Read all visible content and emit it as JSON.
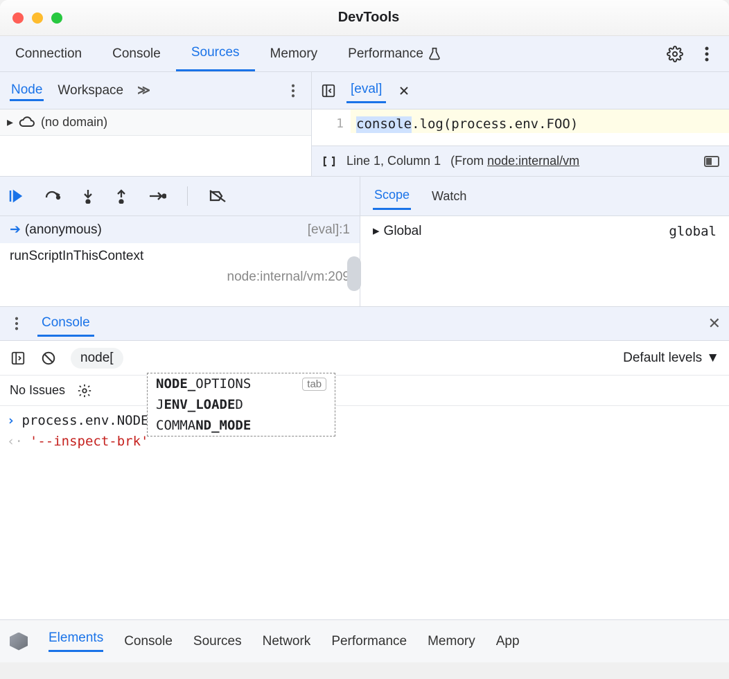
{
  "window": {
    "title": "DevTools"
  },
  "main_tabs": {
    "connection": "Connection",
    "console": "Console",
    "sources": "Sources",
    "memory": "Memory",
    "performance": "Performance"
  },
  "left": {
    "subtabs": {
      "node": "Node",
      "workspace": "Workspace"
    },
    "tree": {
      "no_domain": "(no domain)"
    }
  },
  "file": {
    "tab_name": "[eval]",
    "line_no": "1",
    "code_prefix": "console",
    "code_rest": ".log(process.env.FOO)"
  },
  "status": {
    "location": "Line 1, Column 1",
    "from_label": "(From ",
    "from_link": "node:internal/vm"
  },
  "scope_tabs": {
    "scope": "Scope",
    "watch": "Watch"
  },
  "callstack": {
    "frame0": {
      "name": "(anonymous)",
      "loc": "[eval]:1"
    },
    "frame1": {
      "name": "runScriptInThisContext",
      "loc": "node:internal/vm:209"
    }
  },
  "scope": {
    "global_label": "Global",
    "global_value": "global"
  },
  "drawer": {
    "tab": "Console",
    "context": "node[",
    "levels": "Default levels",
    "issues": "No Issues",
    "input": "process.env.NODE",
    "return_value": "'--inspect-brk'",
    "autocomplete": {
      "opt1_bold": "NODE_",
      "opt1_rest": "OPTIONS",
      "tab_hint": "tab",
      "opt2_pre": "J",
      "opt2_bold": "ENV_LOADE",
      "opt2_post": "D",
      "opt3_pre": "COMMA",
      "opt3_bold": "ND_MODE"
    }
  },
  "bottom": {
    "elements": "Elements",
    "console": "Console",
    "sources": "Sources",
    "network": "Network",
    "performance": "Performance",
    "memory": "Memory",
    "app": "App"
  }
}
